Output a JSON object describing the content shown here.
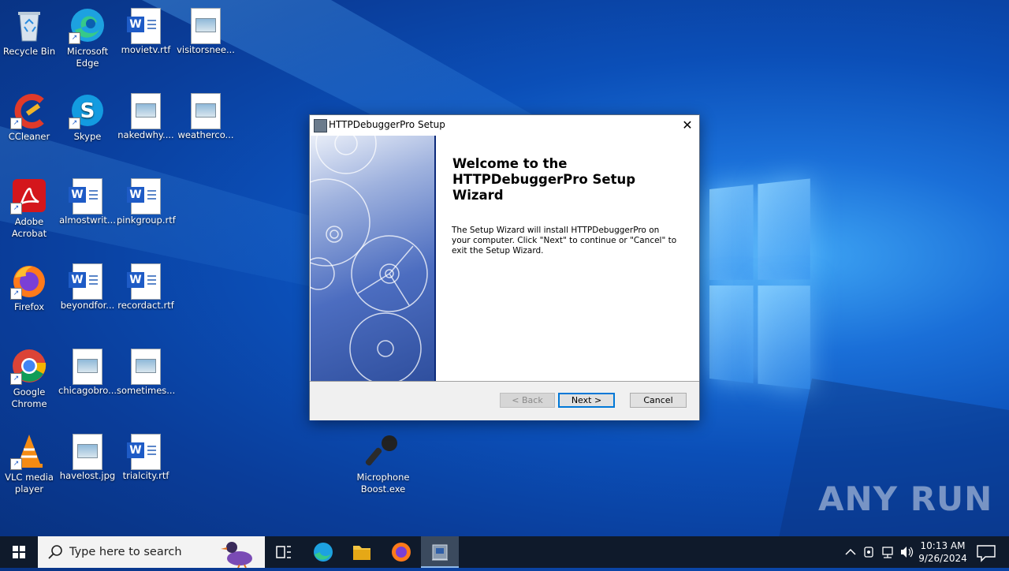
{
  "desktop": {
    "icons": [
      {
        "label": "Recycle Bin"
      },
      {
        "label": "Microsoft Edge"
      },
      {
        "label": "movietv.rtf"
      },
      {
        "label": "visitorsnee..."
      },
      {
        "label": "CCleaner"
      },
      {
        "label": "Skype"
      },
      {
        "label": "nakedwhy...."
      },
      {
        "label": "weatherco..."
      },
      {
        "label": "Adobe Acrobat"
      },
      {
        "label": "almostwrit..."
      },
      {
        "label": "pinkgroup.rtf"
      },
      {
        "label": "Firefox"
      },
      {
        "label": "beyondfor..."
      },
      {
        "label": "recordact.rtf"
      },
      {
        "label": "Google Chrome"
      },
      {
        "label": "chicagobro..."
      },
      {
        "label": "sometimes..."
      },
      {
        "label": "VLC media player"
      },
      {
        "label": "havelost.jpg"
      },
      {
        "label": "trialcity.rtf"
      },
      {
        "label": "Microphone Boost.exe"
      }
    ]
  },
  "dialog": {
    "title": "HTTPDebuggerPro Setup",
    "close_glyph": "✕",
    "heading": "Welcome to the HTTPDebuggerPro Setup Wizard",
    "body": "The Setup Wizard will install HTTPDebuggerPro on your computer.  Click \"Next\" to continue or \"Cancel\" to exit the Setup Wizard.",
    "back_label": "< Back",
    "next_label": "Next >",
    "cancel_label": "Cancel"
  },
  "taskbar": {
    "search_placeholder": "Type here to search",
    "time": "10:13 AM",
    "date": "9/26/2024"
  },
  "watermark": "ANY RUN"
}
